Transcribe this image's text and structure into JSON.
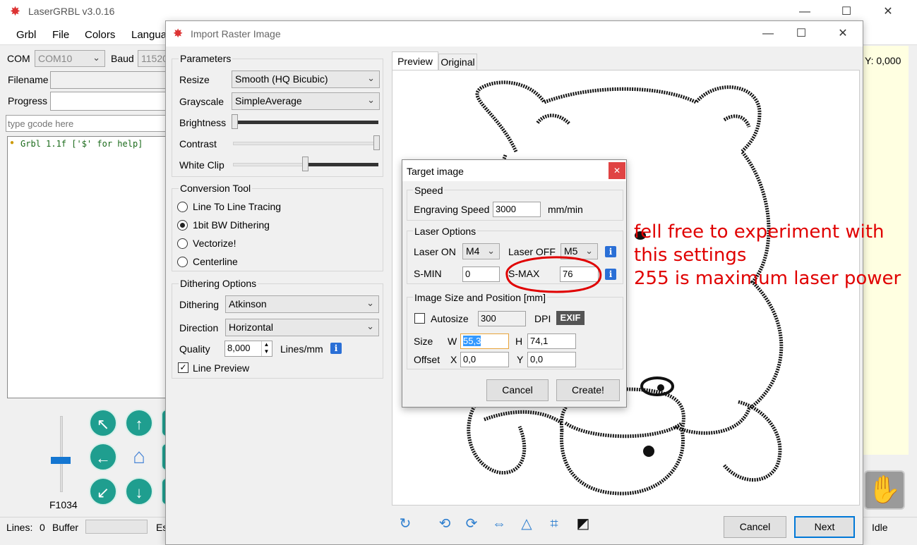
{
  "main_window": {
    "title": "LaserGRBL v3.0.16",
    "menu": [
      "Grbl",
      "File",
      "Colors",
      "Langua"
    ],
    "com_label": "COM",
    "com_value": "COM10",
    "baud_label": "Baud",
    "baud_value": "11520",
    "filename_label": "Filename",
    "progress_label": "Progress",
    "gcode_placeholder": "type gcode here",
    "console_line": "Grbl 1.1f ['$' for help]",
    "feed_label": "F1034",
    "coord_y": "Y: 0,000",
    "status": {
      "lines_label": "Lines:",
      "lines_value": "0",
      "buffer_label": "Buffer",
      "es_label": "Es",
      "state": "Idle"
    }
  },
  "import_dialog": {
    "title": "Import Raster Image",
    "parameters": {
      "title": "Parameters",
      "resize_label": "Resize",
      "resize_value": "Smooth (HQ Bicubic)",
      "grayscale_label": "Grayscale",
      "grayscale_value": "SimpleAverage",
      "brightness_label": "Brightness",
      "contrast_label": "Contrast",
      "whiteclip_label": "White Clip",
      "brightness_level": 0.0,
      "contrast_level": 1.0,
      "whiteclip_level": 0.5
    },
    "conversion": {
      "title": "Conversion Tool",
      "options": [
        "Line To Line Tracing",
        "1bit BW Dithering",
        "Vectorize!",
        "Centerline"
      ],
      "selected": 1
    },
    "dithering": {
      "title": "Dithering Options",
      "dithering_label": "Dithering",
      "dithering_value": "Atkinson",
      "direction_label": "Direction",
      "direction_value": "Horizontal",
      "quality_label": "Quality",
      "quality_value": "8,000",
      "quality_unit": "Lines/mm",
      "line_preview_label": "Line Preview",
      "line_preview_checked": true
    },
    "tabs": [
      "Preview",
      "Original"
    ],
    "active_tab": 0,
    "cancel_label": "Cancel",
    "next_label": "Next"
  },
  "target_dialog": {
    "title": "Target image",
    "speed_group": "Speed",
    "engraving_speed_label": "Engraving Speed",
    "engraving_speed_value": "3000",
    "speed_unit": "mm/min",
    "laser_group": "Laser Options",
    "laser_on_label": "Laser ON",
    "laser_on_value": "M4",
    "laser_off_label": "Laser OFF",
    "laser_off_value": "M5",
    "smin_label": "S-MIN",
    "smin_value": "0",
    "smax_label": "S-MAX",
    "smax_value": "76",
    "size_group": "Image Size and Position [mm]",
    "autosize_label": "Autosize",
    "dpi_value": "300",
    "dpi_label": "DPI",
    "exif_label": "EXIF",
    "size_label": "Size",
    "w_label": "W",
    "w_value": "55,3",
    "h_label": "H",
    "h_value": "74,1",
    "offset_label": "Offset",
    "x_label": "X",
    "x_value": "0,0",
    "y_label": "Y",
    "y_value": "0,0",
    "cancel_label": "Cancel",
    "create_label": "Create!"
  },
  "annotation": {
    "lines": [
      "fell free to experiment with",
      "this settings",
      "255 is maximum laser power"
    ],
    "color": "#e00000"
  }
}
